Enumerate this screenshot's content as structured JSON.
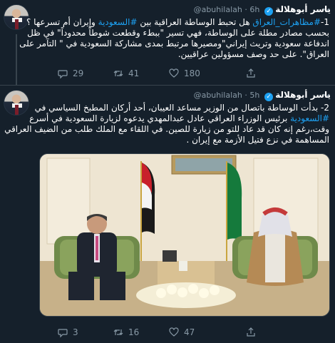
{
  "author": {
    "name": "ياسر أبوهلالة",
    "handle": "@abuhilalah"
  },
  "tweets": [
    {
      "time": "6h",
      "number": "1-",
      "hashtag1": "#مظاهرات_العراق",
      "text_a": " هل تحبط الوساطة العراقية بين ",
      "hashtag2": "#السعودية",
      "text_b": " وإيران أم تسرعها ؟ بحسب مصادر مطلة على الوساطة، فهي تسير \"ببطء وقطعت شوطاً محدوداً\" في ظل اندفاعة سعودية وتريث إيراني\"ومصيرها مرتبط بمدى مشاركة السعودية في \" التآمر على العراق\". على حد وصف مسؤولين عراقيين.",
      "replies": "29",
      "retweets": "41",
      "likes": "180"
    },
    {
      "time": "5h",
      "text_a": "2- بدأت الوساطة باتصال من الوزير مساعد العيبان، أحد أركان المطبخ السياسي في ",
      "hashtag1": "#السعودية",
      "text_b": " برئيس الوزراء العراقي عادل عبدالمهدي يدعوه لزيارة السعودية في أسرع وقت،رغم إنه كان قد عاد للتو من زيارة للصين. في اللقاء مع الملك طلب من الضيف العراقي المساهمة في نزع فتيل الأزمة مع إيران .",
      "replies": "3",
      "retweets": "16",
      "likes": "47"
    }
  ],
  "colors": {
    "background": "#15202b",
    "accent": "#1da1f2",
    "muted": "#8899a6",
    "divider": "#38444d"
  },
  "icons": {
    "reply": "reply-icon",
    "retweet": "retweet-icon",
    "like": "heart-icon",
    "share": "share-icon",
    "more": "chevron-down-icon",
    "verified": "verified-badge-icon"
  }
}
